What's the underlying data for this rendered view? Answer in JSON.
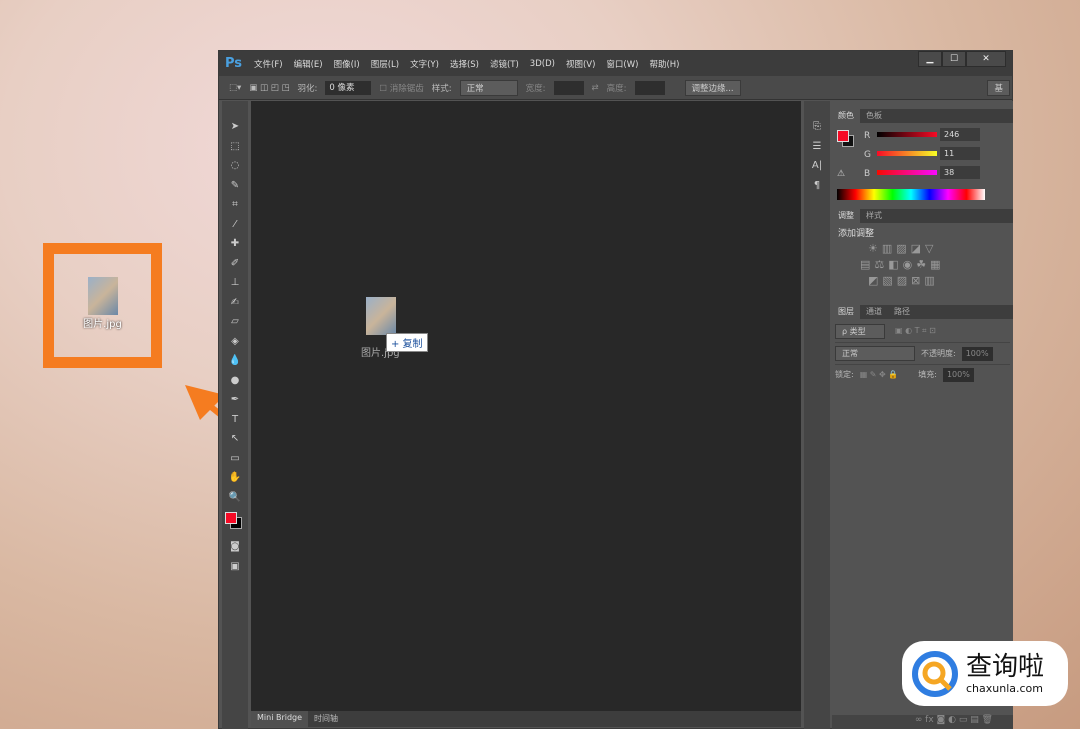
{
  "desktop": {
    "file_label": "图片.jpg"
  },
  "window": {
    "logo": "Ps",
    "menu": [
      "文件(F)",
      "编辑(E)",
      "图像(I)",
      "图层(L)",
      "文字(Y)",
      "选择(S)",
      "滤镜(T)",
      "3D(D)",
      "视图(V)",
      "窗口(W)",
      "帮助(H)"
    ],
    "controls": {
      "minimize": "▁",
      "maximize": "☐",
      "close": "✕"
    }
  },
  "options": {
    "feather_label": "羽化:",
    "feather_value": "0 像素",
    "antialias": "消除锯齿",
    "style_label": "样式:",
    "style_value": "正常",
    "width_label": "宽度:",
    "height_label": "高度:",
    "refine_edge": "调整边缘...",
    "workspace": "基"
  },
  "canvas": {
    "drag_file": "图片.jpg",
    "drag_badge": "+ 复制",
    "tabs": [
      "Mini Bridge",
      "时间轴"
    ]
  },
  "color_panel": {
    "tabs": [
      "颜色",
      "色板"
    ],
    "r": "246",
    "g": "11",
    "b": "38",
    "fg": "#f60b26"
  },
  "adjust_panel": {
    "tabs": [
      "调整",
      "样式"
    ],
    "title": "添加调整"
  },
  "layers_panel": {
    "tabs": [
      "图层",
      "通道",
      "路径"
    ],
    "kind": "ρ 类型",
    "blend": "正常",
    "opacity_label": "不透明度:",
    "opacity": "100%",
    "lock_label": "锁定:",
    "fill_label": "填充:",
    "fill": "100%"
  },
  "watermark": {
    "title": "查询啦",
    "url": "chaxunla.com"
  }
}
